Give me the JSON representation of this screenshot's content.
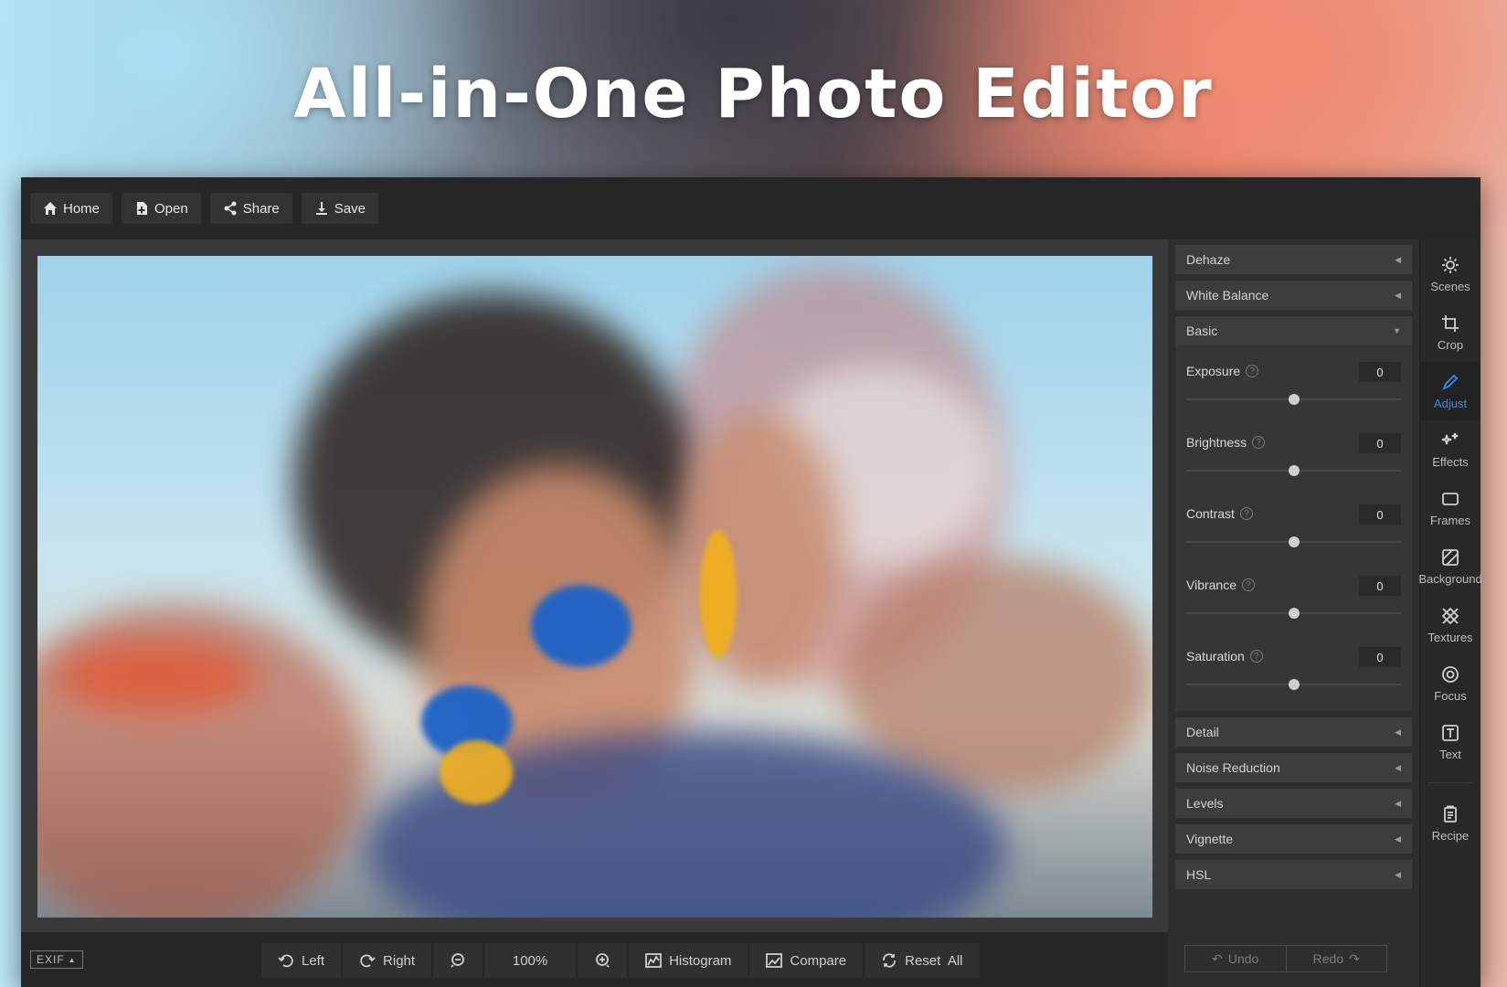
{
  "hero": {
    "title": "All-in-One Photo Editor"
  },
  "toolbar": {
    "home": "Home",
    "open": "Open",
    "share": "Share",
    "save": "Save"
  },
  "panel": {
    "sections_top": [
      {
        "label": "Dehaze"
      },
      {
        "label": "White Balance"
      }
    ],
    "basic": {
      "label": "Basic",
      "adjustments": [
        {
          "label": "Exposure",
          "value": "0",
          "level": 0.5
        },
        {
          "label": "Brightness",
          "value": "0",
          "level": 0.5
        },
        {
          "label": "Contrast",
          "value": "0",
          "level": 0.5
        },
        {
          "label": "Vibrance",
          "value": "0",
          "level": 0.5
        },
        {
          "label": "Saturation",
          "value": "0",
          "level": 0.5
        }
      ]
    },
    "sections_bottom": [
      {
        "label": "Detail"
      },
      {
        "label": "Noise Reduction"
      },
      {
        "label": "Levels"
      },
      {
        "label": "Vignette"
      },
      {
        "label": "HSL"
      }
    ],
    "undo": "Undo",
    "redo": "Redo"
  },
  "rail": [
    {
      "label": "Scenes",
      "icon": "sun-icon"
    },
    {
      "label": "Crop",
      "icon": "crop-icon"
    },
    {
      "label": "Adjust",
      "icon": "pencil-icon",
      "active": true
    },
    {
      "label": "Effects",
      "icon": "sparkle-icon"
    },
    {
      "label": "Frames",
      "icon": "frame-icon"
    },
    {
      "label": "Background",
      "icon": "background-icon"
    },
    {
      "label": "Textures",
      "icon": "texture-icon"
    },
    {
      "label": "Focus",
      "icon": "focus-icon"
    },
    {
      "label": "Text",
      "icon": "text-icon"
    },
    {
      "label": "Recipe",
      "icon": "recipe-icon"
    }
  ],
  "bottombar": {
    "exif": "EXIF",
    "left": "Left",
    "right": "Right",
    "zoom": "100%",
    "histogram": "Histogram",
    "compare": "Compare",
    "reset": "Reset  All"
  },
  "colors": {
    "accent": "#2f8fe8"
  }
}
